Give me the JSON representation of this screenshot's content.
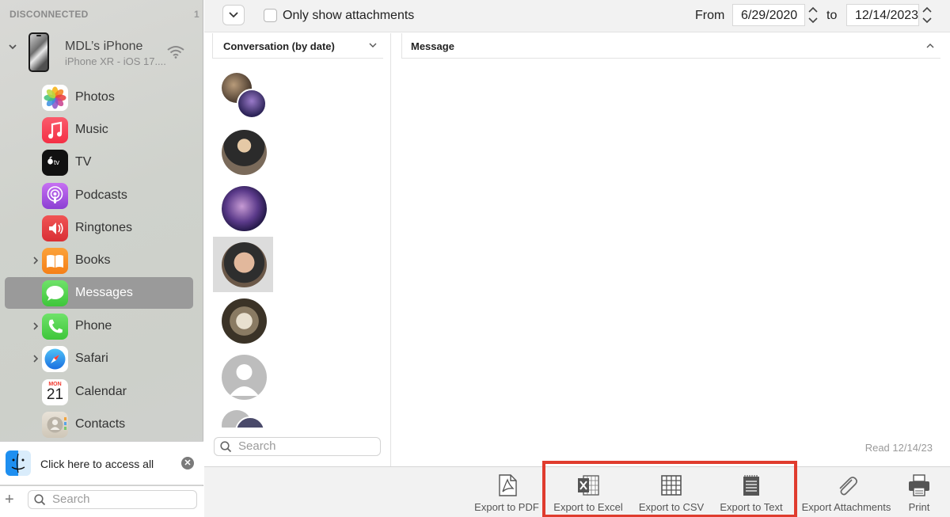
{
  "sidebar": {
    "header": "DISCONNECTED",
    "count": "1",
    "device": {
      "name": "MDL’s iPhone",
      "subtitle": "iPhone XR - iOS 17...."
    },
    "items": [
      {
        "label": "Photos"
      },
      {
        "label": "Music"
      },
      {
        "label": "TV"
      },
      {
        "label": "Podcasts"
      },
      {
        "label": "Ringtones"
      },
      {
        "label": "Books"
      },
      {
        "label": "Messages"
      },
      {
        "label": "Phone"
      },
      {
        "label": "Safari"
      },
      {
        "label": "Calendar",
        "month": "MON",
        "day": "21"
      },
      {
        "label": "Contacts"
      }
    ],
    "finder_text": "Click here to access all",
    "search_placeholder": "Search"
  },
  "toolbar": {
    "only_attachments_label": "Only show attachments",
    "only_attachments_checked": false,
    "from_label": "From",
    "from_date": "6/29/2020",
    "to_label": "to",
    "to_date": "12/14/2023"
  },
  "conversations": {
    "header": "Conversation (by date)",
    "search_placeholder": "Search"
  },
  "message_pane": {
    "header": "Message",
    "read_status": "Read 12/14/23"
  },
  "export_bar": {
    "buttons": [
      {
        "label": "Export to PDF",
        "icon": "pdf-icon"
      },
      {
        "label": "Export to Excel",
        "icon": "excel-icon"
      },
      {
        "label": "Export to CSV",
        "icon": "csv-icon"
      },
      {
        "label": "Export to Text",
        "icon": "text-icon"
      },
      {
        "label": "Export Attachments",
        "icon": "paperclip-icon"
      },
      {
        "label": "Print",
        "icon": "printer-icon"
      }
    ]
  },
  "colors": {
    "highlight": "#e03c2e",
    "selection": "#9a9a9a"
  }
}
